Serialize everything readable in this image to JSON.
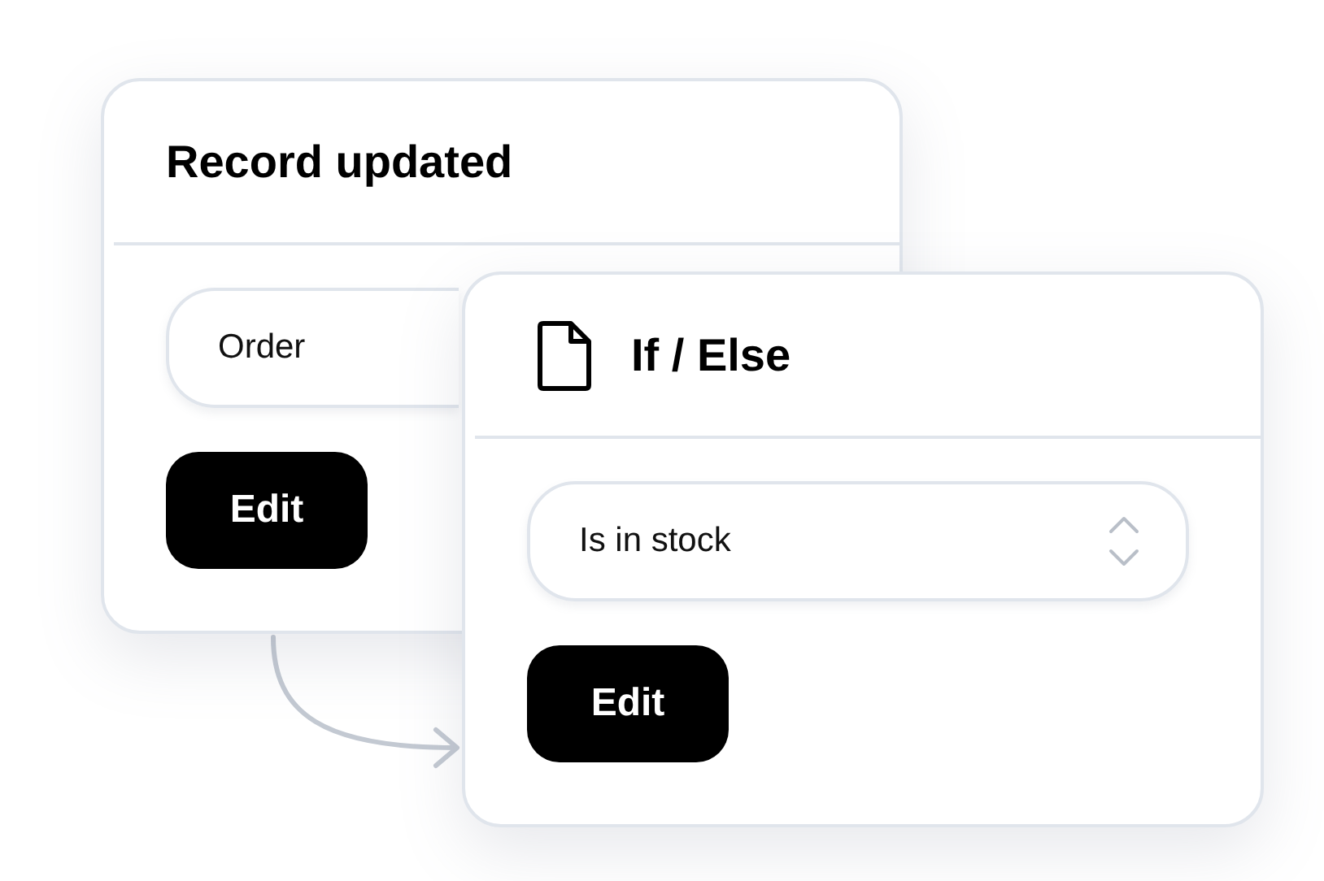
{
  "cards": [
    {
      "kind": "trigger",
      "title": "Record updated",
      "field": {
        "value": "Order"
      },
      "button": "Edit"
    },
    {
      "kind": "condition",
      "title": "If / Else",
      "field": {
        "value": "Is in stock"
      },
      "button": "Edit"
    }
  ]
}
